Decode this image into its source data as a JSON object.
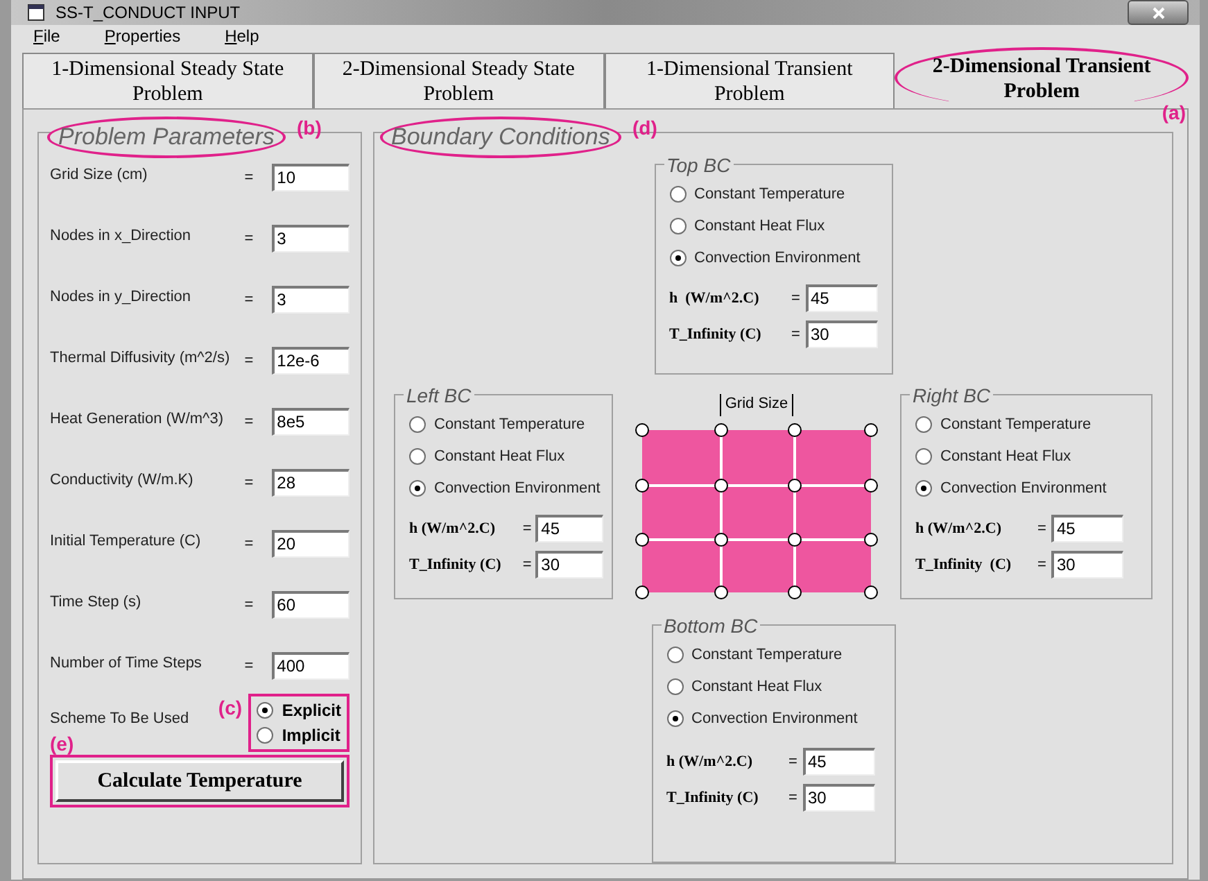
{
  "window": {
    "title": "SS-T_CONDUCT INPUT"
  },
  "menu": [
    "File",
    "Properties",
    "Help"
  ],
  "tabs": [
    {
      "lines": [
        "1-Dimensional Steady State",
        "Problem"
      ],
      "selected": false
    },
    {
      "lines": [
        "2-Dimensional Steady State",
        "Problem"
      ],
      "selected": false
    },
    {
      "lines": [
        "1-Dimensional Transient",
        "Problem"
      ],
      "selected": false
    },
    {
      "lines": [
        "2-Dimensional Transient",
        "Problem"
      ],
      "selected": true,
      "note": "(a)"
    }
  ],
  "parameters": {
    "title": "Problem Parameters",
    "note": "(b)",
    "fields": [
      {
        "label": "Grid Size (cm)",
        "sign": "=",
        "value": "10"
      },
      {
        "label": "Nodes in x_Direction",
        "sign": "=",
        "value": "3"
      },
      {
        "label": "Nodes in y_Direction",
        "sign": "=",
        "value": "3"
      },
      {
        "label": "Thermal Diffusivity (m^2/s)",
        "sign": "=",
        "value": "12e-6"
      },
      {
        "label": "Heat Generation (W/m^3)",
        "sign": "=",
        "value": "8e5"
      },
      {
        "label": "Conductivity (W/m.K)",
        "sign": "=",
        "value": "28"
      },
      {
        "label": "Initial Temperature (C)",
        "sign": "=",
        "value": "20"
      },
      {
        "label": "Time Step (s)",
        "sign": "=",
        "value": "60"
      },
      {
        "label": "Number of Time Steps",
        "sign": "=",
        "value": "400"
      }
    ],
    "scheme": {
      "label": "Scheme To Be Used",
      "note": "(c)",
      "options": [
        {
          "label": "Explicit",
          "selected": true
        },
        {
          "label": "Implicit",
          "selected": false
        }
      ]
    },
    "button": {
      "label": "Calculate Temperature",
      "note": "(e)"
    }
  },
  "boundary": {
    "title": "Boundary Conditions",
    "note": "(d)",
    "grid_label": "Grid Size",
    "conditions": [
      {
        "kind": "top",
        "title": "Top BC",
        "options": [
          {
            "label": "Constant Temperature",
            "selected": false
          },
          {
            "label": "Constant Heat Flux",
            "selected": false
          },
          {
            "label": "Convection Environment",
            "selected": true
          }
        ],
        "fields": [
          {
            "label": "h  (W/m^2.C)",
            "sign": "=",
            "value": "45"
          },
          {
            "label": "T_Infinity (C)",
            "sign": "=",
            "value": "30"
          }
        ]
      },
      {
        "kind": "left",
        "title": "Left BC",
        "options": [
          {
            "label": "Constant Temperature",
            "selected": false
          },
          {
            "label": "Constant Heat Flux",
            "selected": false
          },
          {
            "label": "Convection Environment",
            "selected": true
          }
        ],
        "fields": [
          {
            "label": "h (W/m^2.C)",
            "sign": "=",
            "value": "45"
          },
          {
            "label": "T_Infinity (C)",
            "sign": "=",
            "value": "30"
          }
        ]
      },
      {
        "kind": "right",
        "title": "Right BC",
        "options": [
          {
            "label": "Constant Temperature",
            "selected": false
          },
          {
            "label": "Constant Heat Flux",
            "selected": false
          },
          {
            "label": "Convection Environment",
            "selected": true
          }
        ],
        "fields": [
          {
            "label": "h (W/m^2.C)",
            "sign": "=",
            "value": "45"
          },
          {
            "label": "T_Infinity  (C)",
            "sign": "=",
            "value": "30"
          }
        ]
      },
      {
        "kind": "bottom",
        "title": "Bottom BC",
        "options": [
          {
            "label": "Constant Temperature",
            "selected": false
          },
          {
            "label": "Constant Heat Flux",
            "selected": false
          },
          {
            "label": "Convection Environment",
            "selected": true
          }
        ],
        "fields": [
          {
            "label": "h (W/m^2.C)",
            "sign": "=",
            "value": "45"
          },
          {
            "label": "T_Infinity (C)",
            "sign": "=",
            "value": "30"
          }
        ]
      }
    ]
  }
}
